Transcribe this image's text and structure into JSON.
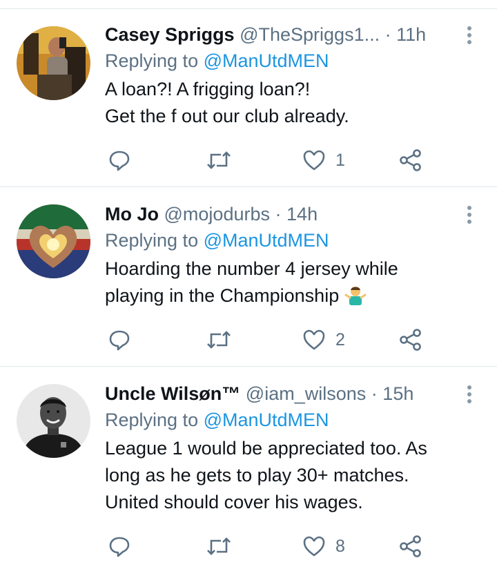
{
  "tweets": [
    {
      "name": "Casey Spriggs",
      "handle": "@TheSpriggs1...",
      "sep": "·",
      "time": "11h",
      "replying_label": "Replying to",
      "replying_to": "@ManUtdMEN",
      "lines": [
        "A loan?! A frigging loan?!",
        "Get the f out our club already."
      ],
      "likes": "1"
    },
    {
      "name": "Mo Jo",
      "handle": "@mojodurbs",
      "sep": "·",
      "time": "14h",
      "replying_label": "Replying to",
      "replying_to": "@ManUtdMEN",
      "lines": [
        "Hoarding the number 4 jersey while",
        "playing in the Championship"
      ],
      "emoji": "man-shrugging-emoji",
      "likes": "2"
    },
    {
      "name": "Uncle Wilsøn™",
      "handle": "@iam_wilsons",
      "sep": "·",
      "time": "15h",
      "replying_label": "Replying to",
      "replying_to": "@ManUtdMEN",
      "lines": [
        "League 1 would be appreciated too. As",
        "long as he gets to play 30+ matches.",
        "United should cover his wages."
      ],
      "likes": "8"
    }
  ],
  "icons": {
    "reply": "reply-icon",
    "retweet": "retweet-icon",
    "like": "heart-icon",
    "share": "share-icon",
    "more": "more-vertical-icon"
  },
  "colors": {
    "secondary_text": "#5b7083",
    "mention": "#1b95e0",
    "divider": "#e1e8ed"
  }
}
